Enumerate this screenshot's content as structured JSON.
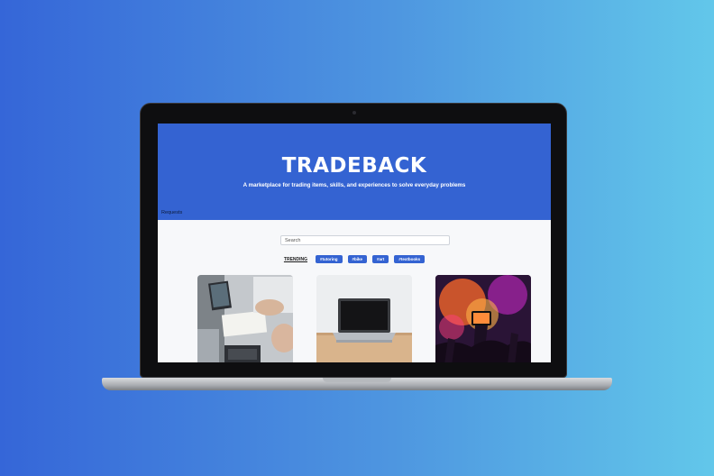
{
  "site": {
    "logo": "TRADEBACK",
    "tagline": "A marketplace for trading items, skills, and experiences to solve everyday problems",
    "nav": {
      "requests_label": "Requests"
    }
  },
  "search": {
    "placeholder": "Search"
  },
  "trending": {
    "label": "TRENDING",
    "tags": [
      "#tutoring",
      "#bike",
      "#art",
      "#textbooks"
    ]
  },
  "cards": [
    {
      "image": "business-meeting-laptop-photo"
    },
    {
      "image": "laptop-on-desk-photo"
    },
    {
      "image": "concert-crowd-phone-photo"
    }
  ],
  "colors": {
    "brand_blue": "#3463d2",
    "background_gradient_start": "#3566d8",
    "background_gradient_end": "#62c7ea"
  }
}
